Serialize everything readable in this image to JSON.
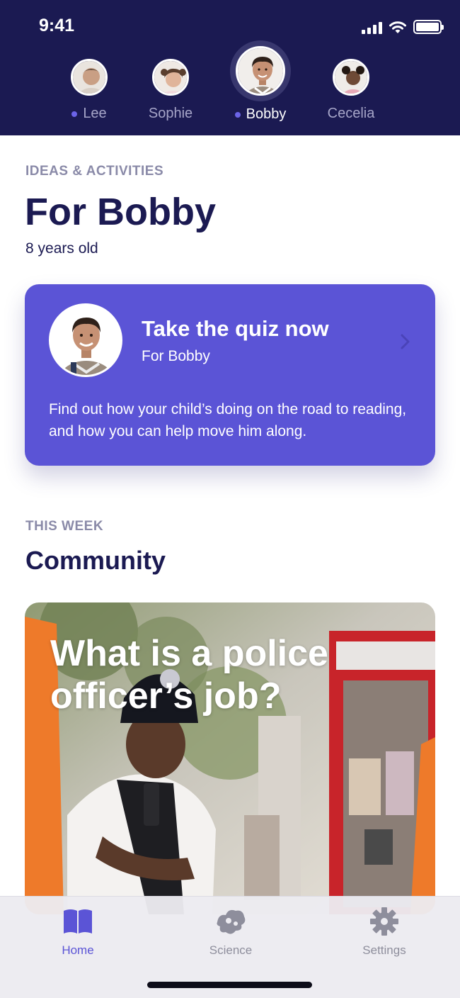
{
  "status_bar": {
    "time": "9:41"
  },
  "profiles": [
    {
      "name": "Lee",
      "has_dot": true,
      "active": false
    },
    {
      "name": "Sophie",
      "has_dot": false,
      "active": false
    },
    {
      "name": "Bobby",
      "has_dot": true,
      "active": true
    },
    {
      "name": "Cecelia",
      "has_dot": false,
      "active": false
    }
  ],
  "ideas": {
    "eyebrow": "IDEAS & ACTIVITIES",
    "title": "For Bobby",
    "subtitle": "8 years old"
  },
  "quiz_card": {
    "title": "Take the quiz now",
    "subtitle": "For Bobby",
    "description": "Find out how your child’s doing on the road to reading, and how you can help move him along."
  },
  "this_week": {
    "eyebrow": "THIS WEEK",
    "title": "Community",
    "feature_title": "What is a police officer’s job?"
  },
  "tabbar": {
    "tabs": [
      {
        "label": "Home",
        "icon": "book-icon",
        "active": true
      },
      {
        "label": "Science",
        "icon": "science-icon",
        "active": false
      },
      {
        "label": "Settings",
        "icon": "gear-icon",
        "active": false
      }
    ]
  },
  "colors": {
    "header": "#1b1a52",
    "accent": "#5b54d6",
    "dot": "#6c64e8",
    "muted_label": "#8a8aa8"
  }
}
